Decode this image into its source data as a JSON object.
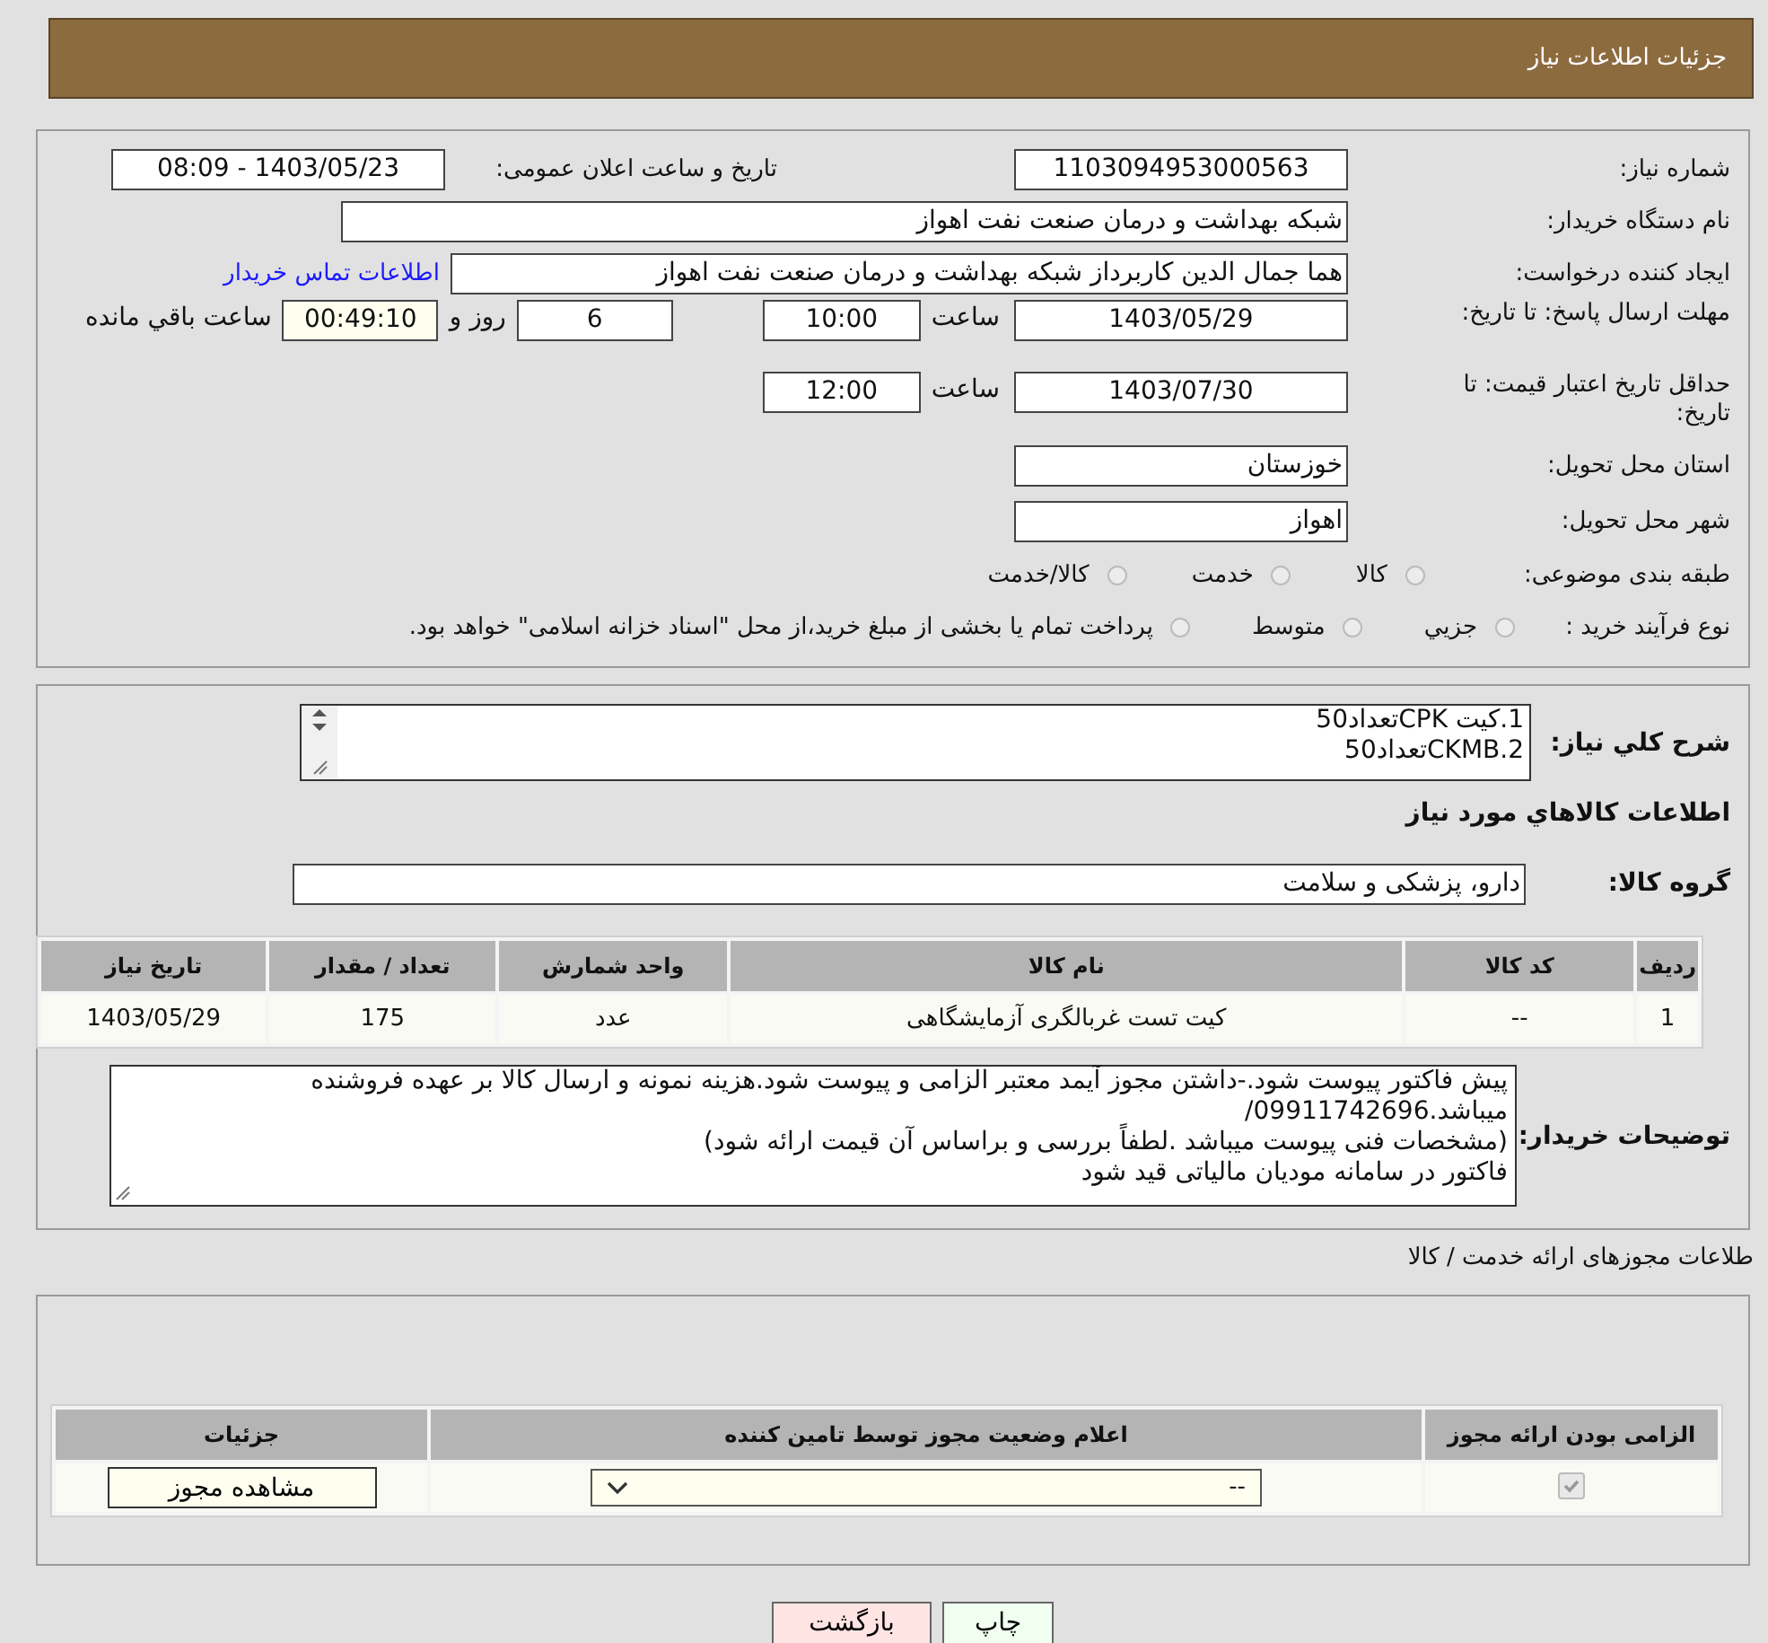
{
  "header": {
    "title": "جزئیات اطلاعات نیاز"
  },
  "details": {
    "need_number": {
      "label": "شماره نیاز:",
      "value": "1103094953000563"
    },
    "announce": {
      "label": "تاریخ و ساعت اعلان عمومی:",
      "value": "1403/05/23 - 08:09"
    },
    "buyer": {
      "label": "نام دستگاه خریدار:",
      "value": "شبکه بهداشت و درمان صنعت نفت اهواز"
    },
    "creator": {
      "label": "ایجاد کننده درخواست:",
      "value": "هما جمال الدین کاربرداز شبکه بهداشت و درمان صنعت نفت اهواز",
      "link": "اطلاعات تماس خریدار"
    },
    "deadline": {
      "label": "مهلت ارسال پاسخ: تا تاریخ:",
      "date": "1403/05/29",
      "time_label": "ساعت",
      "time": "10:00",
      "days": "6",
      "days_label": "روز و",
      "remaining": "00:49:10",
      "remaining_label": "ساعت باقي مانده"
    },
    "validity": {
      "label": "حداقل تاریخ اعتبار قیمت: تا تاریخ:",
      "date": "1403/07/30",
      "time_label": "ساعت",
      "time": "12:00"
    },
    "province": {
      "label": "استان محل تحویل:",
      "value": "خوزستان"
    },
    "city": {
      "label": "شهر محل تحویل:",
      "value": "اهواز"
    },
    "category": {
      "label": "طبقه بندی موضوعی:",
      "options": [
        {
          "label": "کالا",
          "selected": false
        },
        {
          "label": "خدمت",
          "selected": false
        },
        {
          "label": "کالا/خدمت",
          "selected": false
        }
      ]
    },
    "purchase_type": {
      "label": "نوع فرآیند خرید :",
      "options": [
        {
          "label": "جزيي",
          "selected": false
        },
        {
          "label": "متوسط",
          "selected": false
        },
        {
          "label": "پرداخت تمام یا بخشی از مبلغ خرید،از محل \"اسناد خزانه اسلامی\" خواهد بود.",
          "selected": false
        }
      ]
    }
  },
  "summary": {
    "label": "شرح کلي نياز:",
    "lines": [
      "1.کیت CPKتعداد50",
      "2.CKMBتعداد50"
    ]
  },
  "goods": {
    "title": "اطلاعات کالاهاي مورد نياز",
    "group_label": "گروه کالا:",
    "group": "دارو، پزشکی و سلامت",
    "table": {
      "columns": [
        "ردیف",
        "کد کالا",
        "نام کالا",
        "واحد شمارش",
        "تعداد / مقدار",
        "تاریخ نیاز"
      ],
      "rows": [
        [
          "1",
          "--",
          "کیت تست غربالگری آزمایشگاهی",
          "عدد",
          "175",
          "1403/05/29"
        ]
      ]
    }
  },
  "notes": {
    "label": "توضیحات خریدار:",
    "lines": [
      "پیش فاکتور پیوست شود.-داشتن مجوز آیمد معتبر الزامی و پیوست شود.هزینه  نمونه و ارسال کالا بر عهده فروشنده میباشد.09911742696/",
      "(مشخصات فنی پیوست میباشد .لطفاً بررسی و براساس آن قیمت ارائه  شود)",
      "فاکتور در سامانه مودیان مالیاتی قید شود"
    ]
  },
  "licenses": {
    "title": "طلاعات مجوزهای ارائه خدمت / کالا",
    "columns": [
      "الزامی بودن ارائه مجوز",
      "اعلام وضعیت مجوز توسط تامین کننده",
      "جزئیات"
    ],
    "rows": [
      {
        "required": true,
        "disabled": true,
        "status": "--",
        "details_button": "مشاهده مجوز"
      }
    ]
  },
  "buttons": [
    {
      "label": "چاپ",
      "kind": "print"
    },
    {
      "label": "بازگشت",
      "kind": "back"
    }
  ]
}
